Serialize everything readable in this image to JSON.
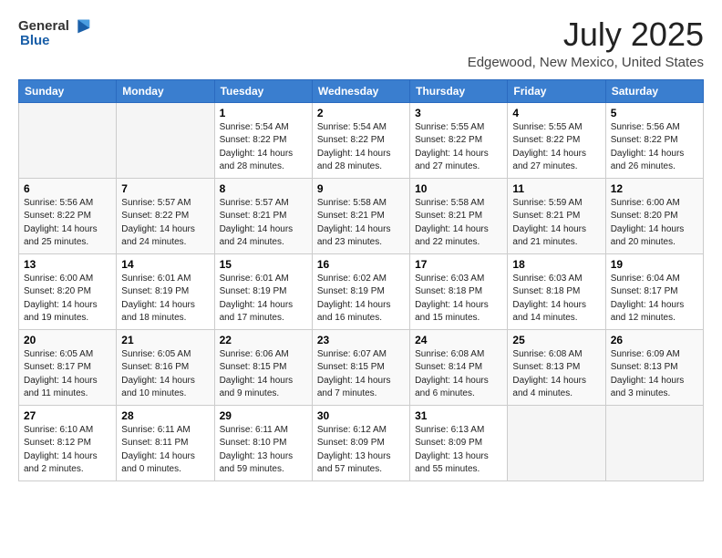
{
  "header": {
    "logo_line1": "General",
    "logo_line2": "Blue",
    "month_year": "July 2025",
    "location": "Edgewood, New Mexico, United States"
  },
  "weekdays": [
    "Sunday",
    "Monday",
    "Tuesday",
    "Wednesday",
    "Thursday",
    "Friday",
    "Saturday"
  ],
  "weeks": [
    [
      {
        "day": "",
        "detail": ""
      },
      {
        "day": "",
        "detail": ""
      },
      {
        "day": "1",
        "detail": "Sunrise: 5:54 AM\nSunset: 8:22 PM\nDaylight: 14 hours\nand 28 minutes."
      },
      {
        "day": "2",
        "detail": "Sunrise: 5:54 AM\nSunset: 8:22 PM\nDaylight: 14 hours\nand 28 minutes."
      },
      {
        "day": "3",
        "detail": "Sunrise: 5:55 AM\nSunset: 8:22 PM\nDaylight: 14 hours\nand 27 minutes."
      },
      {
        "day": "4",
        "detail": "Sunrise: 5:55 AM\nSunset: 8:22 PM\nDaylight: 14 hours\nand 27 minutes."
      },
      {
        "day": "5",
        "detail": "Sunrise: 5:56 AM\nSunset: 8:22 PM\nDaylight: 14 hours\nand 26 minutes."
      }
    ],
    [
      {
        "day": "6",
        "detail": "Sunrise: 5:56 AM\nSunset: 8:22 PM\nDaylight: 14 hours\nand 25 minutes."
      },
      {
        "day": "7",
        "detail": "Sunrise: 5:57 AM\nSunset: 8:22 PM\nDaylight: 14 hours\nand 24 minutes."
      },
      {
        "day": "8",
        "detail": "Sunrise: 5:57 AM\nSunset: 8:21 PM\nDaylight: 14 hours\nand 24 minutes."
      },
      {
        "day": "9",
        "detail": "Sunrise: 5:58 AM\nSunset: 8:21 PM\nDaylight: 14 hours\nand 23 minutes."
      },
      {
        "day": "10",
        "detail": "Sunrise: 5:58 AM\nSunset: 8:21 PM\nDaylight: 14 hours\nand 22 minutes."
      },
      {
        "day": "11",
        "detail": "Sunrise: 5:59 AM\nSunset: 8:21 PM\nDaylight: 14 hours\nand 21 minutes."
      },
      {
        "day": "12",
        "detail": "Sunrise: 6:00 AM\nSunset: 8:20 PM\nDaylight: 14 hours\nand 20 minutes."
      }
    ],
    [
      {
        "day": "13",
        "detail": "Sunrise: 6:00 AM\nSunset: 8:20 PM\nDaylight: 14 hours\nand 19 minutes."
      },
      {
        "day": "14",
        "detail": "Sunrise: 6:01 AM\nSunset: 8:19 PM\nDaylight: 14 hours\nand 18 minutes."
      },
      {
        "day": "15",
        "detail": "Sunrise: 6:01 AM\nSunset: 8:19 PM\nDaylight: 14 hours\nand 17 minutes."
      },
      {
        "day": "16",
        "detail": "Sunrise: 6:02 AM\nSunset: 8:19 PM\nDaylight: 14 hours\nand 16 minutes."
      },
      {
        "day": "17",
        "detail": "Sunrise: 6:03 AM\nSunset: 8:18 PM\nDaylight: 14 hours\nand 15 minutes."
      },
      {
        "day": "18",
        "detail": "Sunrise: 6:03 AM\nSunset: 8:18 PM\nDaylight: 14 hours\nand 14 minutes."
      },
      {
        "day": "19",
        "detail": "Sunrise: 6:04 AM\nSunset: 8:17 PM\nDaylight: 14 hours\nand 12 minutes."
      }
    ],
    [
      {
        "day": "20",
        "detail": "Sunrise: 6:05 AM\nSunset: 8:17 PM\nDaylight: 14 hours\nand 11 minutes."
      },
      {
        "day": "21",
        "detail": "Sunrise: 6:05 AM\nSunset: 8:16 PM\nDaylight: 14 hours\nand 10 minutes."
      },
      {
        "day": "22",
        "detail": "Sunrise: 6:06 AM\nSunset: 8:15 PM\nDaylight: 14 hours\nand 9 minutes."
      },
      {
        "day": "23",
        "detail": "Sunrise: 6:07 AM\nSunset: 8:15 PM\nDaylight: 14 hours\nand 7 minutes."
      },
      {
        "day": "24",
        "detail": "Sunrise: 6:08 AM\nSunset: 8:14 PM\nDaylight: 14 hours\nand 6 minutes."
      },
      {
        "day": "25",
        "detail": "Sunrise: 6:08 AM\nSunset: 8:13 PM\nDaylight: 14 hours\nand 4 minutes."
      },
      {
        "day": "26",
        "detail": "Sunrise: 6:09 AM\nSunset: 8:13 PM\nDaylight: 14 hours\nand 3 minutes."
      }
    ],
    [
      {
        "day": "27",
        "detail": "Sunrise: 6:10 AM\nSunset: 8:12 PM\nDaylight: 14 hours\nand 2 minutes."
      },
      {
        "day": "28",
        "detail": "Sunrise: 6:11 AM\nSunset: 8:11 PM\nDaylight: 14 hours\nand 0 minutes."
      },
      {
        "day": "29",
        "detail": "Sunrise: 6:11 AM\nSunset: 8:10 PM\nDaylight: 13 hours\nand 59 minutes."
      },
      {
        "day": "30",
        "detail": "Sunrise: 6:12 AM\nSunset: 8:09 PM\nDaylight: 13 hours\nand 57 minutes."
      },
      {
        "day": "31",
        "detail": "Sunrise: 6:13 AM\nSunset: 8:09 PM\nDaylight: 13 hours\nand 55 minutes."
      },
      {
        "day": "",
        "detail": ""
      },
      {
        "day": "",
        "detail": ""
      }
    ]
  ]
}
